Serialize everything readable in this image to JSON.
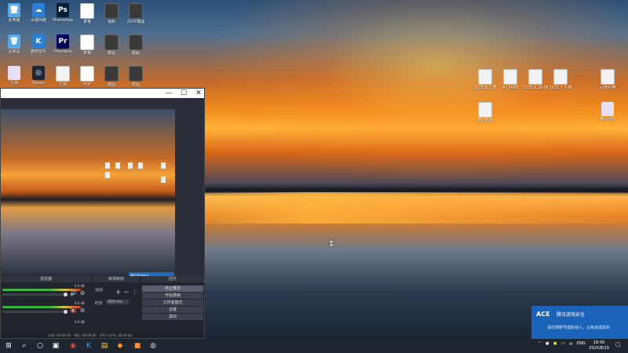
{
  "desktop": {
    "icons_left": [
      {
        "label": "此电脑",
        "type": "pc",
        "glyph": "🖥"
      },
      {
        "label": "百度网盘",
        "type": "blue",
        "glyph": "☁"
      },
      {
        "label": "Photoshop",
        "type": "ps",
        "glyph": "Ps"
      },
      {
        "label": "表格",
        "type": "xls",
        "glyph": "S"
      },
      {
        "label": "视频",
        "type": "img",
        "glyph": ""
      },
      {
        "label": "2025截图",
        "type": "img",
        "glyph": ""
      },
      {
        "label": "回收站",
        "type": "pc",
        "glyph": "🗑"
      },
      {
        "label": "酷狗音乐",
        "type": "blue",
        "glyph": "K"
      },
      {
        "label": "Premiere",
        "type": "pr",
        "glyph": "Pr"
      },
      {
        "label": "表格",
        "type": "xls",
        "glyph": "S"
      },
      {
        "label": "截图",
        "type": "img",
        "glyph": ""
      },
      {
        "label": "截图",
        "type": "img",
        "glyph": ""
      },
      {
        "label": "文档",
        "type": "app",
        "glyph": ""
      },
      {
        "label": "Steam",
        "type": "steam",
        "glyph": "◎"
      },
      {
        "label": "文档",
        "type": "doc",
        "glyph": ""
      },
      {
        "label": "PDF",
        "type": "pdf",
        "glyph": "P"
      },
      {
        "label": "截图",
        "type": "img",
        "glyph": ""
      },
      {
        "label": "截图",
        "type": "img",
        "glyph": ""
      }
    ],
    "icons_right": [
      {
        "label": "2025.8.1-表",
        "type": "doc"
      },
      {
        "label": "4-DIARY",
        "type": "doc"
      },
      {
        "label": "2025.6.26-随",
        "type": "doc"
      },
      {
        "label": "2025.7.6-四",
        "type": "doc"
      },
      {
        "label": "回演女神",
        "type": "doc"
      },
      {
        "label": "梦幻剧游",
        "type": "doc"
      },
      {
        "label": "腾讯网络",
        "type": "app"
      }
    ]
  },
  "obs": {
    "docks": {
      "mixer": "混音器",
      "transitions": "转场特效",
      "controls": "控件"
    },
    "transition_name": "淡出",
    "duration_label": "时长",
    "duration_value": "300 ms",
    "controls": [
      "停止推流",
      "开始录制",
      "工作室模式",
      "设置",
      "退出"
    ],
    "mixer_db": [
      "0.0 dB",
      "0.0 dB",
      "0.0 dB"
    ],
    "status": {
      "live": "LIVE: 00:00:00",
      "rec": "REC: 00:00:00",
      "cpu": "CPU: 0.4%, 30.00 fps"
    }
  },
  "toast": {
    "app": "腾讯游戏安全",
    "message": "请勿将账号借给他人，以免造成损失"
  },
  "taskbar": {
    "lang": "ENG",
    "time": "18:56",
    "date": "2025/8/19"
  },
  "colors": {
    "taskbar_bg": "#1f2630",
    "toast_bg": "#1a63b8",
    "obs_bg": "#2b2e38"
  }
}
